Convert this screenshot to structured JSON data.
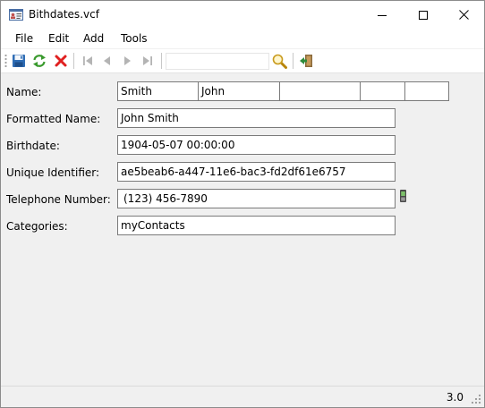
{
  "window": {
    "title": "Bithdates.vcf"
  },
  "menu": {
    "items": [
      "File",
      "Edit",
      "Add",
      "Tools"
    ]
  },
  "toolbar": {
    "search_value": ""
  },
  "form": {
    "name_label": "Name:",
    "name_parts": [
      "Smith",
      "John",
      "",
      "",
      ""
    ],
    "formatted_name_label": "Formatted Name:",
    "formatted_name": "John Smith",
    "birthdate_label": "Birthdate:",
    "birthdate": "1904-05-07 00:00:00",
    "uid_label": "Unique Identifier:",
    "uid": "ae5beab6-a447-11e6-bac3-fd2df61e6757",
    "phone_label": "Telephone Number:",
    "phone": "(123) 456-7890",
    "categories_label": "Categories:",
    "categories": "myContacts"
  },
  "status": {
    "version": "3.0"
  }
}
